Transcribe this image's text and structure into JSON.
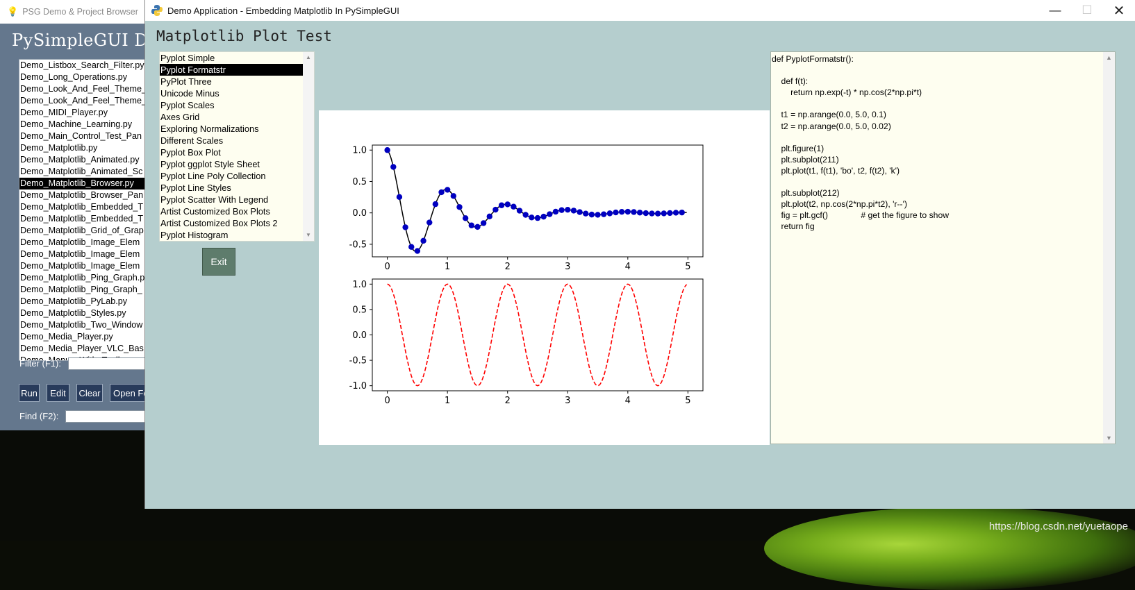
{
  "watermark": "https://blog.csdn.net/yuetaope",
  "background_window": {
    "title": "PSG Demo & Project Browser",
    "heading": "PySimpleGUI Demo",
    "files": [
      "Demo_Listbox_Search_Filter.py",
      "Demo_Long_Operations.py",
      "Demo_Look_And_Feel_Theme_",
      "Demo_Look_And_Feel_Theme_",
      "Demo_MIDI_Player.py",
      "Demo_Machine_Learning.py",
      "Demo_Main_Control_Test_Pan",
      "Demo_Matplotlib.py",
      "Demo_Matplotlib_Animated.py",
      "Demo_Matplotlib_Animated_Sc",
      "Demo_Matplotlib_Browser.py",
      "Demo_Matplotlib_Browser_Pan",
      "Demo_Matplotlib_Embedded_T",
      "Demo_Matplotlib_Embedded_T",
      "Demo_Matplotlib_Grid_of_Grap",
      "Demo_Matplotlib_Image_Elem",
      "Demo_Matplotlib_Image_Elem",
      "Demo_Matplotlib_Image_Elem",
      "Demo_Matplotlib_Ping_Graph.p",
      "Demo_Matplotlib_Ping_Graph_",
      "Demo_Matplotlib_PyLab.py",
      "Demo_Matplotlib_Styles.py",
      "Demo_Matplotlib_Two_Window",
      "Demo_Media_Player.py",
      "Demo_Media_Player_VLC_Bas",
      "Demo_Menus_With_Toolbar"
    ],
    "selected_index": 10,
    "filter_label": "Filter (F1):",
    "find_label": "Find (F2):",
    "buttons": {
      "run": "Run",
      "edit": "Edit",
      "clear": "Clear",
      "open": "Open Folder"
    }
  },
  "main_window": {
    "title": "Demo Application - Embedding Matplotlib In PySimpleGUI",
    "controls": {
      "minimize": "—",
      "maximize": "☐",
      "close": "✕"
    },
    "page_title": "Matplotlib Plot Test",
    "plot_list": [
      "Pyplot Simple",
      "Pyplot Formatstr",
      "PyPlot Three",
      "Unicode Minus",
      "Pyplot Scales",
      "Axes Grid",
      "Exploring Normalizations",
      "Different Scales",
      "Pyplot Box Plot",
      "Pyplot ggplot Style Sheet",
      "Pyplot Line Poly Collection",
      "Pyplot Line Styles",
      "Pyplot Scatter With Legend",
      "Artist Customized Box Plots",
      "Artist Customized Box Plots 2",
      "Pyplot Histogram"
    ],
    "selected_plot_index": 1,
    "exit_label": "Exit",
    "code": "def PyplotFormatstr():\n\n    def f(t):\n        return np.exp(-t) * np.cos(2*np.pi*t)\n\n    t1 = np.arange(0.0, 5.0, 0.1)\n    t2 = np.arange(0.0, 5.0, 0.02)\n\n    plt.figure(1)\n    plt.subplot(211)\n    plt.plot(t1, f(t1), 'bo', t2, f(t2), 'k')\n\n    plt.subplot(212)\n    plt.plot(t2, np.cos(2*np.pi*t2), 'r--')\n    fig = plt.gcf()              # get the figure to show\n    return fig"
  },
  "colors": {
    "window_bg": "#b5cece",
    "list_bg": "#fefef0",
    "exit_button": "#5e7c6c",
    "marker_blue": "#0000c0",
    "line_black": "#000000",
    "dashed_red": "#ff0000"
  },
  "chart_data": [
    {
      "type": "line",
      "function": "exp(-t)*cos(2*pi*t)",
      "markers": {
        "x_start": 0.0,
        "x_stop": 5.0,
        "x_step": 0.1,
        "style": "bo"
      },
      "line": {
        "x_start": 0.0,
        "x_stop": 5.0,
        "x_step": 0.02,
        "style": "k"
      },
      "xticks": [
        "0",
        "1",
        "2",
        "3",
        "4",
        "5"
      ],
      "yticks": [
        "1.0",
        "0.5",
        "0.0",
        "-0.5"
      ],
      "ytick_values": [
        1.0,
        0.5,
        0.0,
        -0.5
      ],
      "xlim": [
        -0.25,
        5.25
      ],
      "ylim": [
        -0.7,
        1.08
      ]
    },
    {
      "type": "line",
      "function": "cos(2*pi*t)",
      "line": {
        "x_start": 0.0,
        "x_stop": 5.0,
        "x_step": 0.02,
        "style": "r--"
      },
      "xticks": [
        "0",
        "1",
        "2",
        "3",
        "4",
        "5"
      ],
      "yticks": [
        "1.0",
        "0.5",
        "0.0",
        "-0.5",
        "-1.0"
      ],
      "ytick_values": [
        1.0,
        0.5,
        0.0,
        -0.5,
        -1.0
      ],
      "xlim": [
        -0.25,
        5.25
      ],
      "ylim": [
        -1.1,
        1.1
      ]
    }
  ]
}
